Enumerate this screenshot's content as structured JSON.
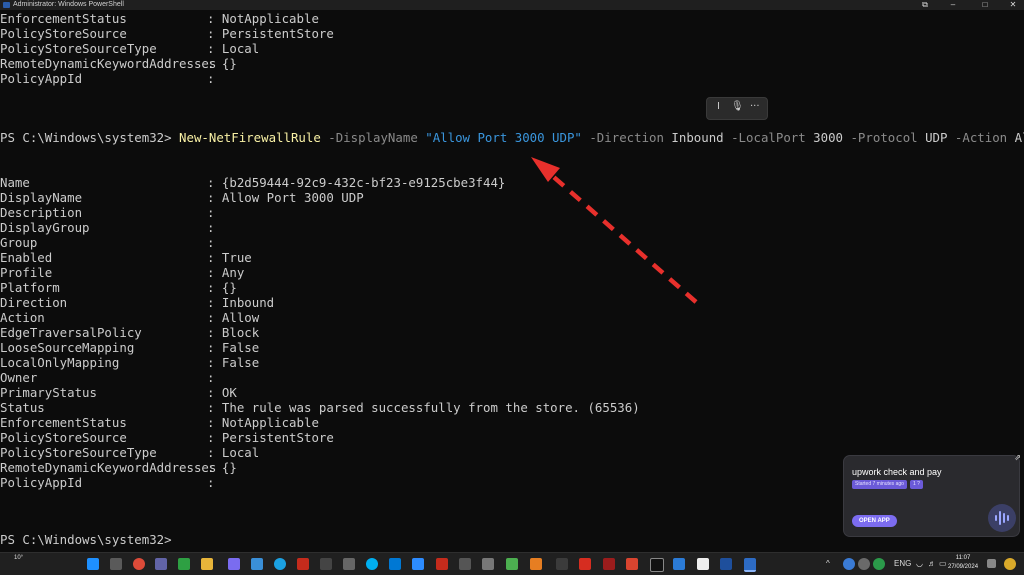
{
  "window": {
    "title": "Administrator: Windows PowerShell",
    "minimize": "–",
    "maximize": "□",
    "close": "✕",
    "extra": "⧉"
  },
  "top_output": [
    {
      "key": "EnforcementStatus",
      "sep": ": ",
      "value": "NotApplicable"
    },
    {
      "key": "PolicyStoreSource",
      "sep": ": ",
      "value": "PersistentStore"
    },
    {
      "key": "PolicyStoreSourceType",
      "sep": ": ",
      "value": "Local"
    },
    {
      "key": "RemoteDynamicKeywordAddresses",
      "sep": ": ",
      "value": "{}"
    },
    {
      "key": "PolicyAppId",
      "sep": ": ",
      "value": ""
    }
  ],
  "command": {
    "prompt": "PS C:\\Windows\\system32> ",
    "cmdlet": "New-NetFirewallRule",
    "p1": " -DisplayName ",
    "v1": "\"Allow Port 3000 UDP\"",
    "p2": " -Direction ",
    "v2": "Inbound",
    "p3": " -LocalPort ",
    "v3": "3000",
    "p4": " -Protocol ",
    "v4": "UDP",
    "p5": " -Action ",
    "v5": "Allow"
  },
  "output": [
    {
      "key": "Name",
      "sep": ": ",
      "value": "{b2d59444-92c9-432c-bf23-e9125cbe3f44}"
    },
    {
      "key": "DisplayName",
      "sep": ": ",
      "value": "Allow Port 3000 UDP"
    },
    {
      "key": "Description",
      "sep": ": ",
      "value": ""
    },
    {
      "key": "DisplayGroup",
      "sep": ": ",
      "value": ""
    },
    {
      "key": "Group",
      "sep": ": ",
      "value": ""
    },
    {
      "key": "Enabled",
      "sep": ": ",
      "value": "True"
    },
    {
      "key": "Profile",
      "sep": ": ",
      "value": "Any"
    },
    {
      "key": "Platform",
      "sep": ": ",
      "value": "{}"
    },
    {
      "key": "Direction",
      "sep": ": ",
      "value": "Inbound"
    },
    {
      "key": "Action",
      "sep": ": ",
      "value": "Allow"
    },
    {
      "key": "EdgeTraversalPolicy",
      "sep": ": ",
      "value": "Block"
    },
    {
      "key": "LooseSourceMapping",
      "sep": ": ",
      "value": "False"
    },
    {
      "key": "LocalOnlyMapping",
      "sep": ": ",
      "value": "False"
    },
    {
      "key": "Owner",
      "sep": ": ",
      "value": ""
    },
    {
      "key": "PrimaryStatus",
      "sep": ": ",
      "value": "OK"
    },
    {
      "key": "Status",
      "sep": ": ",
      "value": "The rule was parsed successfully from the store. (65536)"
    },
    {
      "key": "EnforcementStatus",
      "sep": ": ",
      "value": "NotApplicable"
    },
    {
      "key": "PolicyStoreSource",
      "sep": ": ",
      "value": "PersistentStore"
    },
    {
      "key": "PolicyStoreSourceType",
      "sep": ": ",
      "value": "Local"
    },
    {
      "key": "RemoteDynamicKeywordAddresses",
      "sep": ": ",
      "value": "{}"
    },
    {
      "key": "PolicyAppId",
      "sep": ": ",
      "value": ""
    }
  ],
  "final_prompt": "PS C:\\Windows\\system32>",
  "mini_toolbar": {
    "cursor": "I",
    "mic": "🎙",
    "more": "···"
  },
  "annotation": {
    "color": "#e8302c",
    "icon": "dashed-red-arrow"
  },
  "toast": {
    "title": "upwork check and pay",
    "tag1": "Started 7 minutes ago",
    "tag2": "1 ?",
    "button": "OPEN APP",
    "external": "⇗"
  },
  "taskbar": {
    "weather": "10°",
    "tray_arrow": "^",
    "language": "ENG",
    "time": "11:07",
    "date": "27/09/2024",
    "colors": {
      "start": "#1e90ff",
      "chrome": "#dd4b39",
      "teams": "#6264a7",
      "powershell": "#2d6bc4"
    }
  }
}
